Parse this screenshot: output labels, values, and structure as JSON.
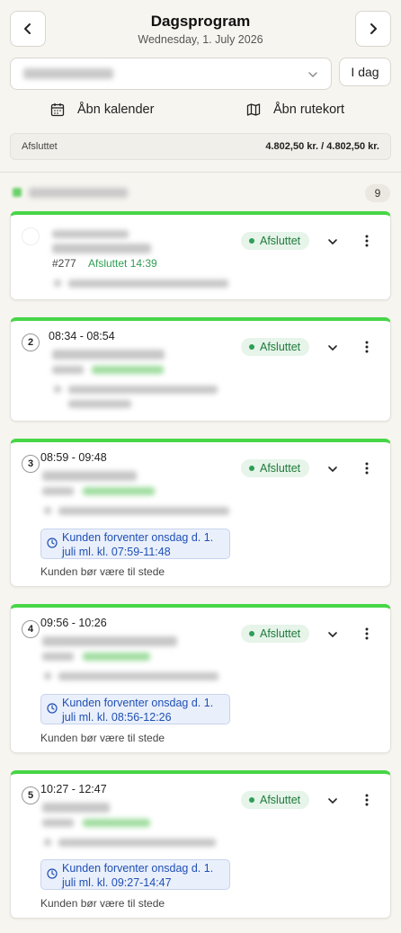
{
  "header": {
    "title": "Dagsprogram",
    "date": "Wednesday, 1. July 2026",
    "today_label": "I dag"
  },
  "actions": {
    "calendar_label": "Åbn kalender",
    "route_label": "Åbn rutekort"
  },
  "summary": {
    "status": "Afsluttet",
    "amount": "4.802,50 kr. / 4.802,50 kr."
  },
  "group": {
    "count": "9"
  },
  "cards": [
    {
      "number": "",
      "time": "",
      "status": "Afsluttet",
      "order": "#277",
      "completed": "Afsluttet 14:39",
      "note": "",
      "presence": ""
    },
    {
      "number": "2",
      "time": "08:34 - 08:54",
      "status": "Afsluttet",
      "order": "",
      "completed": "",
      "note": "",
      "presence": ""
    },
    {
      "number": "3",
      "time": "08:59 - 09:48",
      "status": "Afsluttet",
      "order": "",
      "completed": "",
      "note": "Kunden forventer onsdag d. 1. juli ml. kl. 07:59-11:48",
      "presence": "Kunden bør være til stede"
    },
    {
      "number": "4",
      "time": "09:56 - 10:26",
      "status": "Afsluttet",
      "order": "",
      "completed": "",
      "note": "Kunden forventer onsdag d. 1. juli ml. kl. 08:56-12:26",
      "presence": "Kunden bør være til stede"
    },
    {
      "number": "5",
      "time": "10:27 - 12:47",
      "status": "Afsluttet",
      "order": "",
      "completed": "",
      "note": "Kunden forventer onsdag d. 1. juli ml. kl. 09:27-14:47",
      "presence": "Kunden bør være til stede"
    }
  ],
  "icons": {
    "back": "chevron-left-icon",
    "forward": "chevron-right-icon",
    "calendar": "calendar-icon",
    "map": "map-icon",
    "expand": "chevron-down-icon",
    "more": "kebab-icon",
    "clock": "clock-icon"
  },
  "colors": {
    "accent_green": "#46d646",
    "status_bg": "#e6f4ea",
    "status_text": "#1f7a3a",
    "note_bg": "#eaf0fb",
    "note_text": "#1f4fb5"
  }
}
